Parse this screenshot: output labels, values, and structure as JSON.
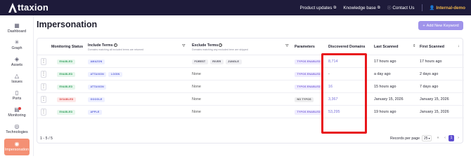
{
  "app": {
    "name": "ttaxion"
  },
  "topnav": {
    "product_updates": "Product updates",
    "knowledge_base": "Knowledge base",
    "contact_us": "Contact Us",
    "org": "Internal-demo"
  },
  "sidebar": {
    "items": [
      {
        "label": "Dashboard",
        "icon": "dashboard-icon"
      },
      {
        "label": "Graph",
        "icon": "graph-icon"
      },
      {
        "label": "Assets",
        "icon": "assets-icon"
      },
      {
        "label": "Issues",
        "icon": "issues-icon"
      },
      {
        "label": "Ports",
        "icon": "ports-icon"
      },
      {
        "label": "Monitoring",
        "icon": "monitoring-icon"
      },
      {
        "label": "Technologies",
        "icon": "technologies-icon"
      },
      {
        "label": "Impersonation",
        "icon": "impersonation-icon",
        "active": true
      }
    ]
  },
  "page": {
    "title": "Impersonation",
    "add_button": "Add New Keyword"
  },
  "table": {
    "headers": {
      "monitoring_status": "Monitoring Status",
      "include_terms": "Include Terms",
      "include_sub": "Domains matching all included terms are returned",
      "exclude_terms": "Exclude Terms",
      "exclude_sub": "Domains matching any excluded term are skipped",
      "parameters": "Parameters",
      "discovered_domains": "Discovered Domains",
      "last_scanned": "Last Scanned",
      "first_scanned": "First Scanned"
    },
    "rows": [
      {
        "status": "ENABLED",
        "include": [
          "AMAZON"
        ],
        "exclude": [
          "FOREST",
          "RIVER",
          "JUNGLE"
        ],
        "exclude_none": "",
        "parameters": "TYPOS ENABLED",
        "discovered": "8,714",
        "last": "17 hours ago",
        "first": "17 hours ago"
      },
      {
        "status": "ENABLED",
        "include": [
          "ATTAXION",
          "LOGIN"
        ],
        "exclude": [],
        "exclude_none": "None",
        "parameters": "TYPOS ENABLED",
        "discovered": "-",
        "last": "a day ago",
        "first": "2 days ago"
      },
      {
        "status": "ENABLED",
        "include": [
          "ATTAXION"
        ],
        "exclude": [],
        "exclude_none": "None",
        "parameters": "TYPOS ENABLED",
        "discovered": "16",
        "last": "15 hours ago",
        "first": "7 days ago"
      },
      {
        "status": "DISABLED",
        "include": [
          "GOOGLE"
        ],
        "exclude": [],
        "exclude_none": "None",
        "parameters": "NO TYPOS",
        "discovered": "3,367",
        "last": "January 15, 2026",
        "first": "January 15, 2026"
      },
      {
        "status": "ENABLED",
        "include": [
          "APPLE"
        ],
        "exclude": [],
        "exclude_none": "None",
        "parameters": "TYPOS ENABLED",
        "discovered": "53,295",
        "last": "19 hours ago",
        "first": "January 15, 2026"
      }
    ]
  },
  "footer": {
    "count": "1 - 5 / 5",
    "records_label": "Records per page",
    "records_value": "25",
    "current_page": "1"
  }
}
